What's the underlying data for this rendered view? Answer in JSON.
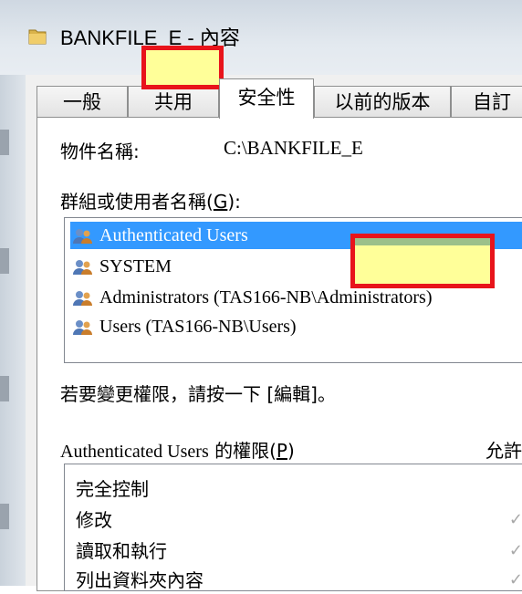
{
  "window": {
    "title": "BANKFILE_E - 內容",
    "icon": "folder-icon"
  },
  "tabs": [
    {
      "label": "一般",
      "active": false
    },
    {
      "label": "共用",
      "active": false
    },
    {
      "label": "安全性",
      "active": true
    },
    {
      "label": "以前的版本",
      "active": false
    },
    {
      "label": "自訂",
      "active": false
    }
  ],
  "security": {
    "object_name_label": "物件名稱:",
    "object_name_value": "C:\\BANKFILE_E",
    "groups_label_prefix": "群組或使用者名稱(",
    "groups_label_key": "G",
    "groups_label_suffix": "):",
    "groups": [
      {
        "name": "Authenticated Users",
        "selected": true,
        "icon": "users-icon"
      },
      {
        "name": "SYSTEM",
        "selected": false,
        "icon": "users-icon"
      },
      {
        "name": "Administrators (TAS166-NB\\Administrators)",
        "selected": false,
        "icon": "users-icon"
      },
      {
        "name": "Users (TAS166-NB\\Users)",
        "selected": false,
        "icon": "users-icon"
      }
    ],
    "edit_hint": "若要變更權限，請按一下 [編輯]。",
    "permissions_label_user": "Authenticated Users",
    "permissions_label_prefix": " 的權限(",
    "permissions_label_key": "P",
    "permissions_label_suffix": ")",
    "allow_header": "允許",
    "permissions": [
      {
        "name": "完全控制",
        "allow": ""
      },
      {
        "name": "修改",
        "allow": "✓"
      },
      {
        "name": "讀取和執行",
        "allow": "✓"
      },
      {
        "name": "列出資料夾內容",
        "allow": "✓"
      }
    ]
  },
  "colors": {
    "selection": "#3399ff",
    "redaction_fill": "#ffff99",
    "redaction_border": "#e8141b"
  }
}
